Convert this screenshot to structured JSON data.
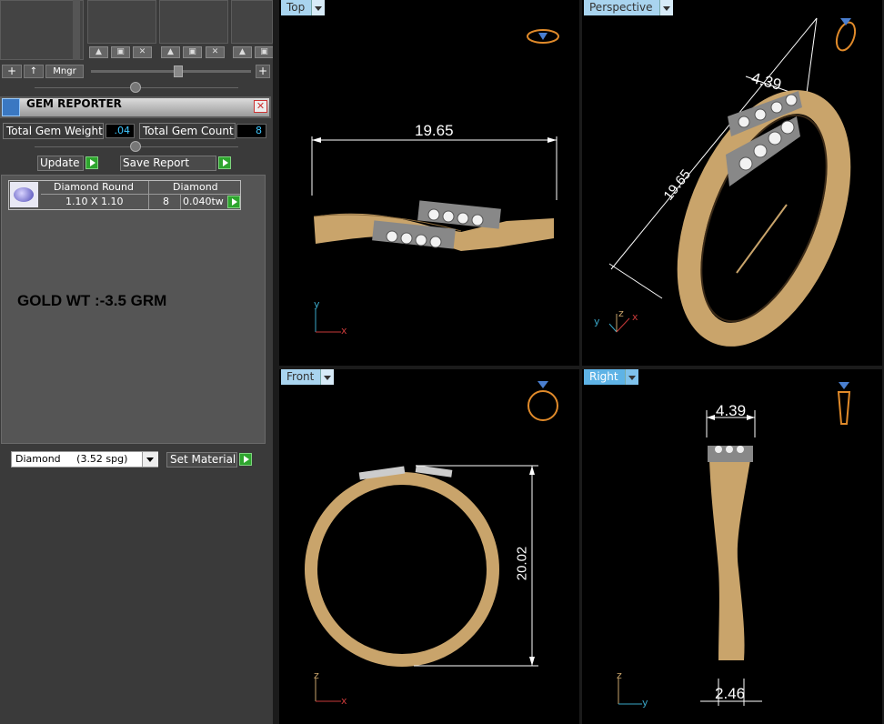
{
  "manager": {
    "mngr_label": "Mngr",
    "add_symbol": "+",
    "up_symbol": "↑",
    "plus_symbol": "+"
  },
  "gem_reporter": {
    "title": "GEM REPORTER",
    "total_weight_label": "Total Gem Weight",
    "total_weight_value": ".04",
    "total_count_label": "Total Gem Count",
    "total_count_value": "8",
    "update_label": "Update",
    "save_report_label": "Save Report",
    "table": {
      "headers": [
        "Diamond Round",
        "Diamond"
      ],
      "rows": [
        {
          "size": "1.10 X 1.10",
          "count": "8",
          "weight": "0.040tw"
        }
      ]
    },
    "note": "GOLD WT :-3.5 GRM",
    "material_select": "Diamond     (3.52 spg)",
    "set_material_label": "Set Material"
  },
  "viewports": {
    "top": {
      "label": "Top",
      "dim": "19.65",
      "axis_y": "y",
      "axis_x": "x"
    },
    "perspective": {
      "label": "Perspective",
      "dim_a": "4.39",
      "dim_b": "19.65",
      "axis_y": "y",
      "axis_z": "z",
      "axis_x": "x"
    },
    "front": {
      "label": "Front",
      "dim": "20.02",
      "axis_z": "z",
      "axis_x": "x"
    },
    "right": {
      "label": "Right",
      "dim_a": "4.39",
      "dim_b": "2.46",
      "axis_z": "z",
      "axis_y": "y"
    }
  },
  "colors": {
    "panel_bg": "#3a3a3a",
    "metal": "#c9a46b",
    "tab_active": "#5eb3e6",
    "accent_value": "#3fc7ff",
    "icon_orange": "#e08a2a"
  }
}
